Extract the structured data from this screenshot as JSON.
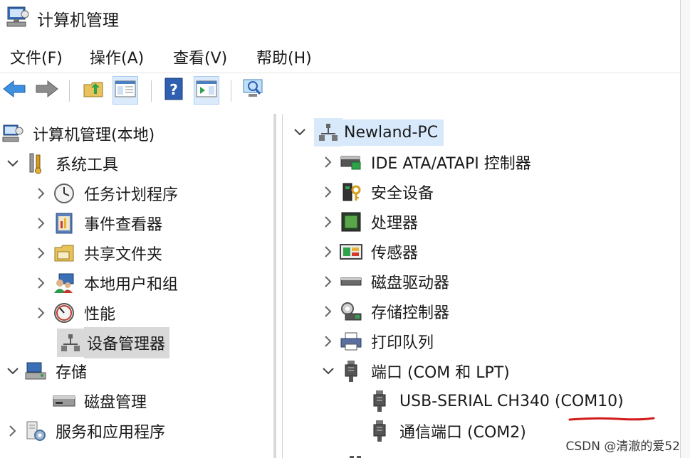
{
  "window": {
    "title": "计算机管理"
  },
  "menu": [
    "文件(F)",
    "操作(A)",
    "查看(V)",
    "帮助(H)"
  ],
  "left_tree": [
    {
      "label": "计算机管理(本地)",
      "icon": "computer-management-icon"
    },
    {
      "label": "系统工具",
      "icon": "tools-icon"
    },
    {
      "label": "任务计划程序",
      "icon": "clock-icon"
    },
    {
      "label": "事件查看器",
      "icon": "event-viewer-icon"
    },
    {
      "label": "共享文件夹",
      "icon": "shared-folder-icon"
    },
    {
      "label": "本地用户和组",
      "icon": "users-icon"
    },
    {
      "label": "性能",
      "icon": "performance-icon"
    },
    {
      "label": "设备管理器",
      "icon": "device-manager-icon"
    },
    {
      "label": "存储",
      "icon": "storage-icon"
    },
    {
      "label": "磁盘管理",
      "icon": "disk-icon"
    },
    {
      "label": "服务和应用程序",
      "icon": "services-icon"
    }
  ],
  "right_tree": [
    {
      "label": "Newland-PC",
      "icon": "computer-icon"
    },
    {
      "label": "IDE ATA/ATAPI 控制器",
      "icon": "ide-controller-icon"
    },
    {
      "label": "安全设备",
      "icon": "security-device-icon"
    },
    {
      "label": "处理器",
      "icon": "processor-icon"
    },
    {
      "label": "传感器",
      "icon": "sensor-icon"
    },
    {
      "label": "磁盘驱动器",
      "icon": "disk-drive-icon"
    },
    {
      "label": "存储控制器",
      "icon": "storage-controller-icon"
    },
    {
      "label": "打印队列",
      "icon": "printer-icon"
    },
    {
      "label": "端口 (COM 和 LPT)",
      "icon": "port-icon"
    },
    {
      "label": "USB-SERIAL CH340 (COM10)",
      "icon": "port-icon"
    },
    {
      "label": "通信端口 (COM2)",
      "icon": "port-icon"
    }
  ],
  "watermark": "CSDN @清澈的爱52",
  "colors": {
    "accent": "#2e7fd6",
    "annotation": "#d21a1a",
    "selection": "#d9d9d9"
  }
}
